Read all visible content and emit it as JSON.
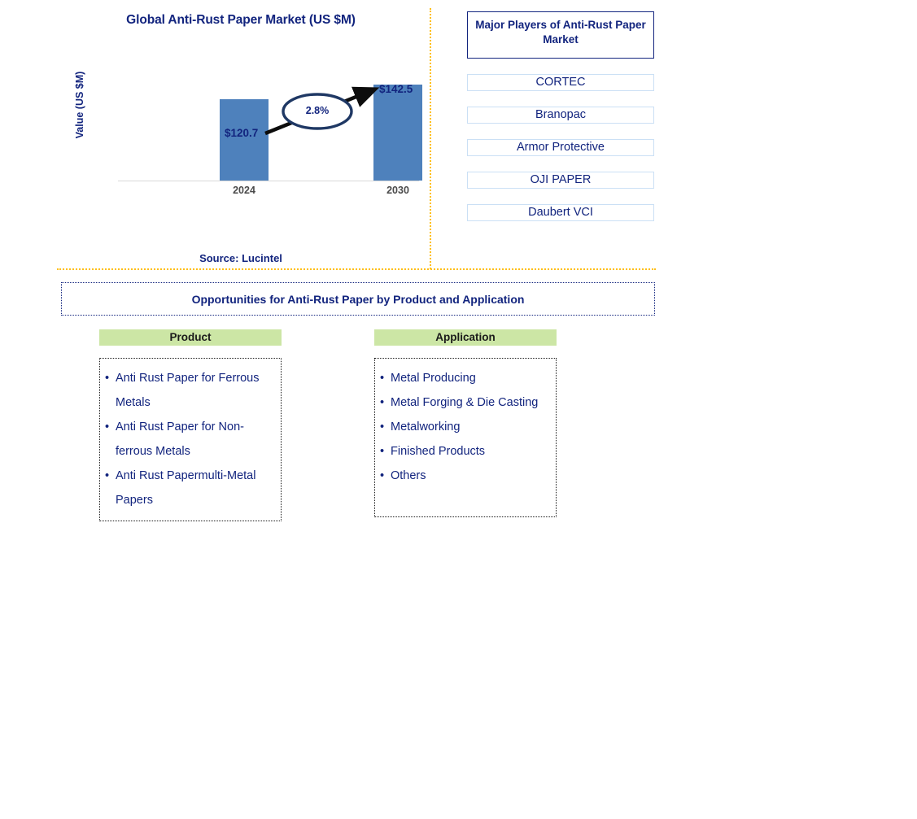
{
  "chart_data": {
    "type": "bar",
    "title": "Global Anti-Rust Paper Market (US $M)",
    "xlabel": "",
    "ylabel": "Value (US $M)",
    "categories": [
      "2024",
      "2030"
    ],
    "values": [
      120.7,
      142.5
    ],
    "value_labels": [
      "$120.7",
      "$142.5"
    ],
    "ylim": [
      0,
      160
    ],
    "grid": false,
    "legend": "none",
    "bar_color": "#4E81BC",
    "annotations": [
      {
        "text": "2.8%",
        "type": "cagr-callout",
        "shape": "ellipse-with-arrow"
      }
    ],
    "source": "Source: Lucintel"
  },
  "chart": {
    "title": "Global Anti-Rust Paper Market (US $M)",
    "ylabel": "Value (US $M)",
    "cagr": "2.8%",
    "source": "Source: Lucintel",
    "bars": [
      {
        "category": "2024",
        "label": "$120.7"
      },
      {
        "category": "2030",
        "label": "$142.5"
      }
    ]
  },
  "players": {
    "header": "Major Players of Anti-Rust Paper Market",
    "items": [
      "CORTEC",
      "Branopac",
      "Armor Protective",
      "OJI PAPER",
      "Daubert VCI"
    ]
  },
  "opportunities": {
    "banner": "Opportunities for Anti-Rust Paper by Product and Application",
    "columns": [
      {
        "header": "Product",
        "items": [
          "Anti Rust Paper for Ferrous Metals",
          "Anti Rust Paper for Non-ferrous Metals",
          "Anti Rust Papermulti-Metal Papers"
        ]
      },
      {
        "header": "Application",
        "items": [
          "Metal Producing",
          "Metal Forging & Die Casting",
          "Metalworking",
          "Finished Products",
          "Others"
        ]
      }
    ]
  },
  "colors": {
    "brand_navy": "#12247E",
    "bar_blue": "#4E81BC",
    "header_green": "#CCE6A5",
    "divider_amber": "#FFBF15",
    "player_border": "#CBE0F5"
  }
}
